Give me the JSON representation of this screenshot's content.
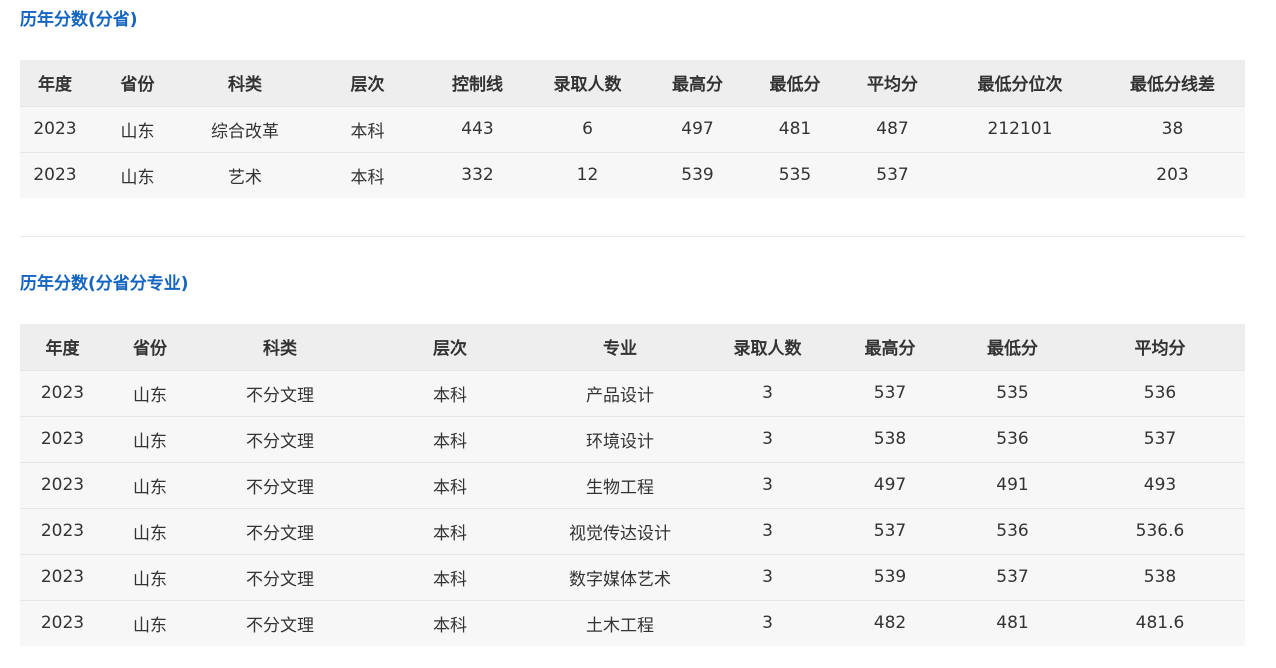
{
  "section1": {
    "title": "历年分数(分省)",
    "headers": [
      "年度",
      "省份",
      "科类",
      "层次",
      "控制线",
      "录取人数",
      "最高分",
      "最低分",
      "平均分",
      "最低分位次",
      "最低分线差"
    ],
    "rows": [
      [
        "2023",
        "山东",
        "综合改革",
        "本科",
        "443",
        "6",
        "497",
        "481",
        "487",
        "212101",
        "38"
      ],
      [
        "2023",
        "山东",
        "艺术",
        "本科",
        "332",
        "12",
        "539",
        "535",
        "537",
        "",
        "203"
      ]
    ]
  },
  "section2": {
    "title": "历年分数(分省分专业)",
    "headers": [
      "年度",
      "省份",
      "科类",
      "层次",
      "专业",
      "录取人数",
      "最高分",
      "最低分",
      "平均分"
    ],
    "rows": [
      [
        "2023",
        "山东",
        "不分文理",
        "本科",
        "产品设计",
        "3",
        "537",
        "535",
        "536"
      ],
      [
        "2023",
        "山东",
        "不分文理",
        "本科",
        "环境设计",
        "3",
        "538",
        "536",
        "537"
      ],
      [
        "2023",
        "山东",
        "不分文理",
        "本科",
        "生物工程",
        "3",
        "497",
        "491",
        "493"
      ],
      [
        "2023",
        "山东",
        "不分文理",
        "本科",
        "视觉传达设计",
        "3",
        "537",
        "536",
        "536.6"
      ],
      [
        "2023",
        "山东",
        "不分文理",
        "本科",
        "数字媒体艺术",
        "3",
        "539",
        "537",
        "538"
      ],
      [
        "2023",
        "山东",
        "不分文理",
        "本科",
        "土木工程",
        "3",
        "482",
        "481",
        "481.6"
      ]
    ]
  },
  "colors": {
    "title": "#1565c0",
    "header_bg": "#eeeeee",
    "row_bg": "#f7f7f7",
    "text": "#333333"
  }
}
